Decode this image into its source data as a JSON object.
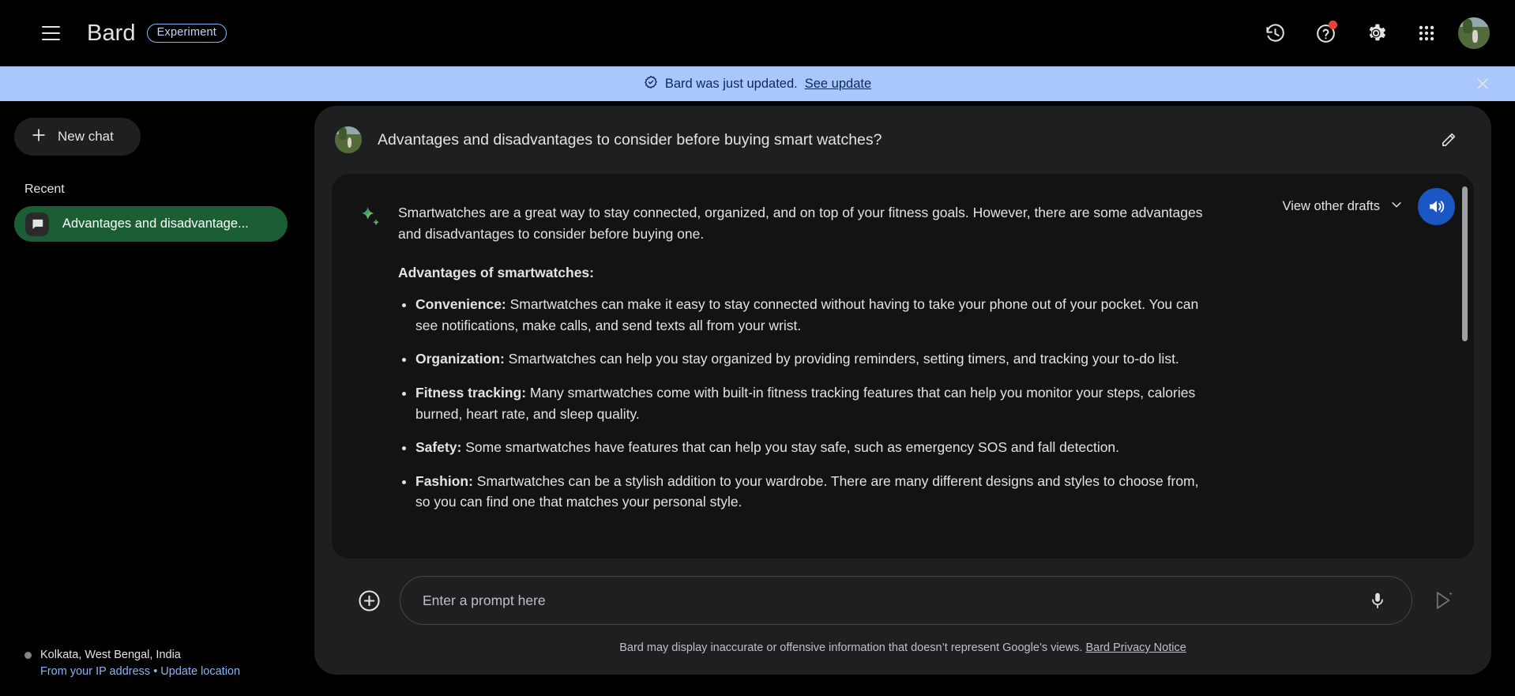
{
  "topbar": {
    "menu_icon": "hamburger-menu-icon",
    "brand": "Bard",
    "badge": "Experiment",
    "actions": [
      {
        "name": "history-icon",
        "label": "Activity"
      },
      {
        "name": "help-icon",
        "label": "Help",
        "has_notification": true
      },
      {
        "name": "gear-icon",
        "label": "Settings"
      },
      {
        "name": "apps-grid-icon",
        "label": "Google apps"
      },
      {
        "name": "avatar",
        "label": "Google Account"
      }
    ]
  },
  "banner": {
    "icon": "verified-check-icon",
    "text": "Bard was just updated.",
    "link": "See update",
    "close_icon": "close-icon",
    "background": "#a8c7fa",
    "text_color": "#0b2a5b"
  },
  "sidebar": {
    "new_chat_label": "New chat",
    "new_chat_icon": "plus-icon",
    "recent_label": "Recent",
    "chats": [
      {
        "label": "Advantages and disadvantage...",
        "icon": "chat-bubble-icon",
        "active": true,
        "active_color": "#1b5e34"
      }
    ],
    "location": {
      "name": "Kolkata, West Bengal, India",
      "source": "From your IP address",
      "separator": "•",
      "update_link": "Update location"
    }
  },
  "main": {
    "query": {
      "text": "Advantages and disadvantages to consider before buying smart watches?",
      "avatar": "user-avatar",
      "edit_icon": "pencil-edit-icon"
    },
    "answer": {
      "drafts_label": "View other drafts",
      "drafts_chevron": "chevron-down-icon",
      "speaker_icon": "speaker-icon",
      "speaker_color": "#1a56c4",
      "bard_icon": "bard-sparkle-icon",
      "intro": "Smartwatches are a great way to stay connected, organized, and on top of your fitness goals. However, there are some advantages and disadvantages to consider before buying one.",
      "subheading": "Advantages of smartwatches:",
      "bullets": [
        {
          "label": "Convenience:",
          "text": " Smartwatches can make it easy to stay connected without having to take your phone out of your pocket. You can see notifications, make calls, and send texts all from your wrist."
        },
        {
          "label": "Organization:",
          "text": " Smartwatches can help you stay organized by providing reminders, setting timers, and tracking your to-do list."
        },
        {
          "label": "Fitness tracking:",
          "text": " Many smartwatches come with built-in fitness tracking features that can help you monitor your steps, calories burned, heart rate, and sleep quality."
        },
        {
          "label": "Safety:",
          "text": " Some smartwatches have features that can help you stay safe, such as emergency SOS and fall detection."
        },
        {
          "label": "Fashion:",
          "text": " Smartwatches can be a stylish addition to your wardrobe. There are many different designs and styles to choose from, so you can find one that matches your personal style."
        }
      ]
    },
    "input": {
      "plus_icon": "plus-circle-icon",
      "placeholder": "Enter a prompt here",
      "value": "",
      "mic_icon": "microphone-icon",
      "send_icon": "send-icon"
    },
    "disclaimer": {
      "text": "Bard may display inaccurate or offensive information that doesn’t represent Google’s views.",
      "link": "Bard Privacy Notice"
    }
  }
}
